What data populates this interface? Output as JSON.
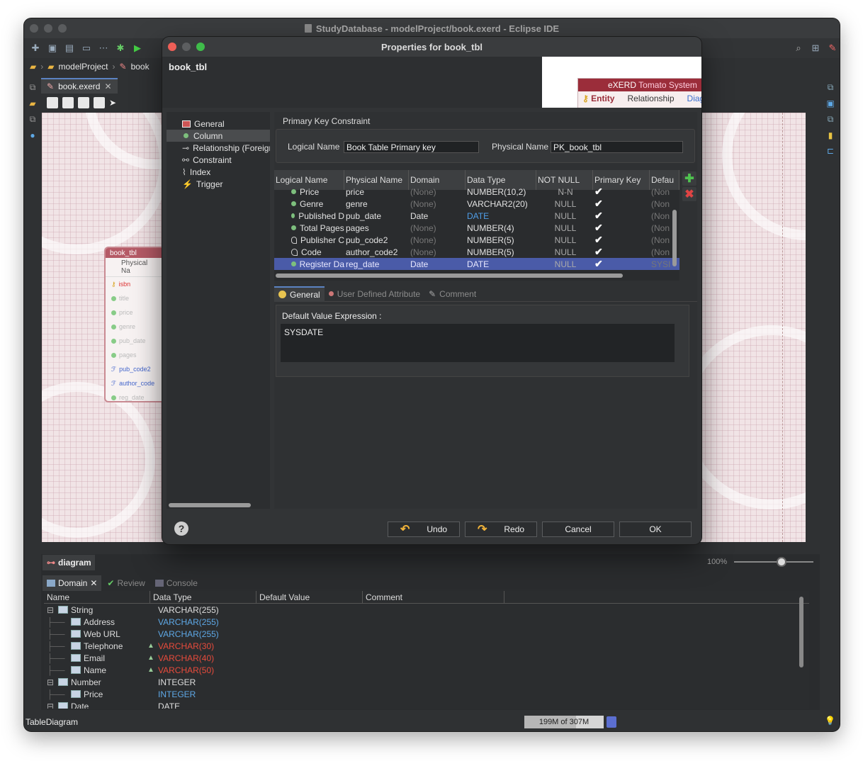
{
  "ide": {
    "title": "StudyDatabase - modelProject/book.exerd - Eclipse IDE",
    "breadcrumb": [
      "modelProject",
      "book"
    ],
    "editor_tab": "book.exerd",
    "entity": {
      "name": "book_tbl",
      "header": "Physical Na",
      "columns": [
        "isbn",
        "title",
        "price",
        "genre",
        "pub_date",
        "pages",
        "pub_code2",
        "author_code",
        "reg_date"
      ]
    },
    "bottom": {
      "diagram_tab": "diagram",
      "zoom": "100%",
      "zoom_level": 0.6,
      "tabs": [
        "Domain",
        "Review",
        "Console"
      ],
      "columns": [
        "Name",
        "Data Type",
        "Default Value",
        "Comment"
      ],
      "rows": [
        {
          "name": "String",
          "type": "VARCHAR(255)",
          "level": 0,
          "style": "normal",
          "warn": false
        },
        {
          "name": "Address",
          "type": "VARCHAR(255)",
          "level": 1,
          "style": "blue",
          "warn": false
        },
        {
          "name": "Web URL",
          "type": "VARCHAR(255)",
          "level": 1,
          "style": "blue",
          "warn": false
        },
        {
          "name": "Telephone",
          "type": "VARCHAR(30)",
          "level": 1,
          "style": "red",
          "warn": true
        },
        {
          "name": "Email",
          "type": "VARCHAR(40)",
          "level": 1,
          "style": "red",
          "warn": true
        },
        {
          "name": "Name",
          "type": "VARCHAR(50)",
          "level": 1,
          "style": "red",
          "warn": true
        },
        {
          "name": "Number",
          "type": "INTEGER",
          "level": 0,
          "style": "normal",
          "warn": false
        },
        {
          "name": "Price",
          "type": "INTEGER",
          "level": 1,
          "style": "blue",
          "warn": false
        },
        {
          "name": "Date",
          "type": "DATE",
          "level": 0,
          "style": "normal",
          "warn": false
        }
      ]
    },
    "status": "TableDiagram",
    "heap": "199M of 307M",
    "heap_used_fraction": 0.65
  },
  "dialog": {
    "title": "Properties for book_tbl",
    "table_name": "book_tbl",
    "banner": {
      "brand": "eXERD",
      "sub": "Tomato System",
      "links": [
        "Entity",
        "Relationship",
        "Diag"
      ]
    },
    "nav": [
      "General",
      "Column",
      "Relationship (Foreign",
      "Constraint",
      "Index",
      "Trigger"
    ],
    "nav_selected": 1,
    "pk": {
      "title": "Primary Key Constraint",
      "logical_label": "Logical Name",
      "logical_value": "Book Table Primary key",
      "physical_label": "Physical Name",
      "physical_value": "PK_book_tbl"
    },
    "columns_table": {
      "headers": [
        "Logical Name",
        "Physical Name",
        "Domain",
        "Data Type",
        "NOT NULL",
        "Primary Key",
        "Defau"
      ],
      "rows": [
        {
          "logical": "Price",
          "physical": "price",
          "domain": "(None)",
          "type": "NUMBER(10,2)",
          "notnull": "N-N",
          "pk": "✔",
          "default": "(Non",
          "icon": "col",
          "typeStyle": "",
          "partial": true
        },
        {
          "logical": "Genre",
          "physical": "genre",
          "domain": "(None)",
          "type": "VARCHAR2(20)",
          "notnull": "NULL",
          "pk": "✔",
          "default": "(Non",
          "icon": "col",
          "typeStyle": ""
        },
        {
          "logical": "Published D",
          "physical": "pub_date",
          "domain": "Date",
          "type": "DATE",
          "notnull": "NULL",
          "pk": "✔",
          "default": "(Non",
          "icon": "col",
          "typeStyle": "blue"
        },
        {
          "logical": "Total Pages",
          "physical": "pages",
          "domain": "(None)",
          "type": "NUMBER(4)",
          "notnull": "NULL",
          "pk": "✔",
          "default": "(Non",
          "icon": "col",
          "typeStyle": ""
        },
        {
          "logical": "Publisher C",
          "physical": "pub_code2",
          "domain": "(None)",
          "type": "NUMBER(5)",
          "notnull": "NULL",
          "pk": "✔",
          "default": "(Non",
          "icon": "fk",
          "typeStyle": ""
        },
        {
          "logical": "Code",
          "physical": "author_code2",
          "domain": "(None)",
          "type": "NUMBER(5)",
          "notnull": "NULL",
          "pk": "✔",
          "default": "(Non",
          "icon": "fk",
          "typeStyle": ""
        },
        {
          "logical": "Register Da",
          "physical": "reg_date",
          "domain": "Date",
          "type": "DATE",
          "notnull": "NULL",
          "pk": "✔",
          "default": "SYSI",
          "icon": "col",
          "typeStyle": "",
          "selected": true
        }
      ]
    },
    "subtabs": [
      "General",
      "User Defined Attribute",
      "Comment"
    ],
    "default_value": {
      "label": "Default Value Expression :",
      "value": "SYSDATE"
    },
    "buttons": {
      "undo": "Undo",
      "redo": "Redo",
      "cancel": "Cancel",
      "ok": "OK",
      "help": "?"
    },
    "colors": {
      "accent": "#5b83c2",
      "selected_row": "#4a5ba8",
      "add": "#4fc24f",
      "remove": "#e04444"
    }
  }
}
